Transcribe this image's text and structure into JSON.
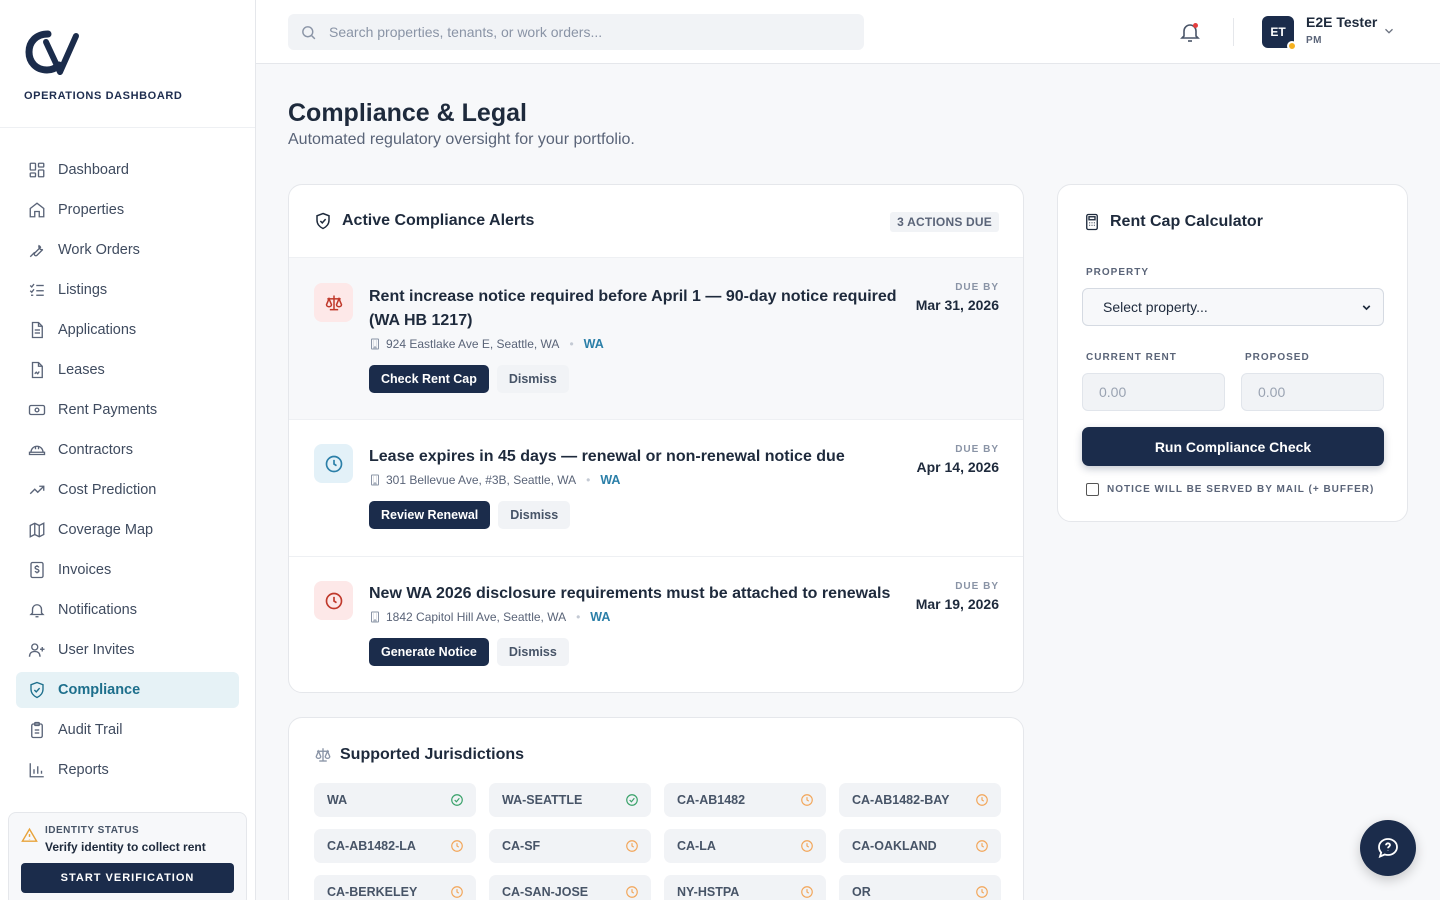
{
  "brand": {
    "tagline": "OPERATIONS DASHBOARD"
  },
  "sidebar": {
    "items": [
      {
        "label": "Dashboard",
        "icon": "grid-icon"
      },
      {
        "label": "Properties",
        "icon": "home-icon"
      },
      {
        "label": "Work Orders",
        "icon": "wrench-icon"
      },
      {
        "label": "Listings",
        "icon": "list-check-icon"
      },
      {
        "label": "Applications",
        "icon": "document-icon"
      },
      {
        "label": "Leases",
        "icon": "signed-document-icon"
      },
      {
        "label": "Rent Payments",
        "icon": "banknote-icon"
      },
      {
        "label": "Contractors",
        "icon": "hard-hat-icon"
      },
      {
        "label": "Cost Prediction",
        "icon": "trending-up-icon"
      },
      {
        "label": "Coverage Map",
        "icon": "map-icon"
      },
      {
        "label": "Invoices",
        "icon": "dollar-receipt-icon"
      },
      {
        "label": "Notifications",
        "icon": "bell-icon"
      },
      {
        "label": "User Invites",
        "icon": "user-plus-icon"
      },
      {
        "label": "Compliance",
        "icon": "shield-check-icon",
        "active": true
      },
      {
        "label": "Audit Trail",
        "icon": "clipboard-icon"
      },
      {
        "label": "Reports",
        "icon": "bar-chart-icon"
      }
    ],
    "identity": {
      "label": "IDENTITY STATUS",
      "message": "Verify identity to collect rent",
      "button": "START VERIFICATION"
    }
  },
  "header": {
    "search_placeholder": "Search properties, tenants, or work orders...",
    "user": {
      "initials": "ET",
      "name": "E2E Tester",
      "role": "PM"
    }
  },
  "page": {
    "title": "Compliance & Legal",
    "subtitle": "Automated regulatory oversight for your portfolio."
  },
  "alerts": {
    "title": "Active Compliance Alerts",
    "badge": "3 ACTIONS DUE",
    "due_label": "DUE BY",
    "items": [
      {
        "title": "Rent increase notice required before April 1 — 90-day notice required (WA HB 1217)",
        "address": "924 Eastlake Ave E, Seattle, WA",
        "jurisdiction": "WA",
        "due": "Mar 31, 2026",
        "primary": "Check Rent Cap",
        "secondary": "Dismiss",
        "icon": "scale-icon"
      },
      {
        "title": "Lease expires in 45 days — renewal or non-renewal notice due",
        "address": "301 Bellevue Ave, #3B, Seattle, WA",
        "jurisdiction": "WA",
        "due": "Apr 14, 2026",
        "primary": "Review Renewal",
        "secondary": "Dismiss",
        "icon": "clock-icon"
      },
      {
        "title": "New WA 2026 disclosure requirements must be attached to renewals",
        "address": "1842 Capitol Hill Ave, Seattle, WA",
        "jurisdiction": "WA",
        "due": "Mar 19, 2026",
        "primary": "Generate Notice",
        "secondary": "Dismiss",
        "icon": "clock-icon"
      }
    ]
  },
  "jurisdictions": {
    "title": "Supported Jurisdictions",
    "items": [
      {
        "code": "WA",
        "status": "active"
      },
      {
        "code": "WA-SEATTLE",
        "status": "active"
      },
      {
        "code": "CA-AB1482",
        "status": "pending"
      },
      {
        "code": "CA-AB1482-BAY",
        "status": "pending"
      },
      {
        "code": "CA-AB1482-LA",
        "status": "pending"
      },
      {
        "code": "CA-SF",
        "status": "pending"
      },
      {
        "code": "CA-LA",
        "status": "pending"
      },
      {
        "code": "CA-OAKLAND",
        "status": "pending"
      },
      {
        "code": "CA-BERKELEY",
        "status": "pending"
      },
      {
        "code": "CA-SAN-JOSE",
        "status": "pending"
      },
      {
        "code": "NY-HSTPA",
        "status": "pending"
      },
      {
        "code": "OR",
        "status": "pending"
      }
    ]
  },
  "rent_cap": {
    "title": "Rent Cap Calculator",
    "property_label": "PROPERTY",
    "property_value": "Select property...",
    "current_label": "CURRENT RENT",
    "current_placeholder": "0.00",
    "proposed_label": "PROPOSED",
    "proposed_placeholder": "0.00",
    "run_button": "Run Compliance Check",
    "mail_checkbox": "NOTICE WILL BE SERVED BY MAIL (+ BUFFER)",
    "mail_checked": false
  },
  "colors": {
    "navy": "#1b2c4b",
    "accent_teal": "#1d6f8c",
    "danger": "#c0392b",
    "success": "#38a169",
    "pending": "#f2a65a"
  }
}
